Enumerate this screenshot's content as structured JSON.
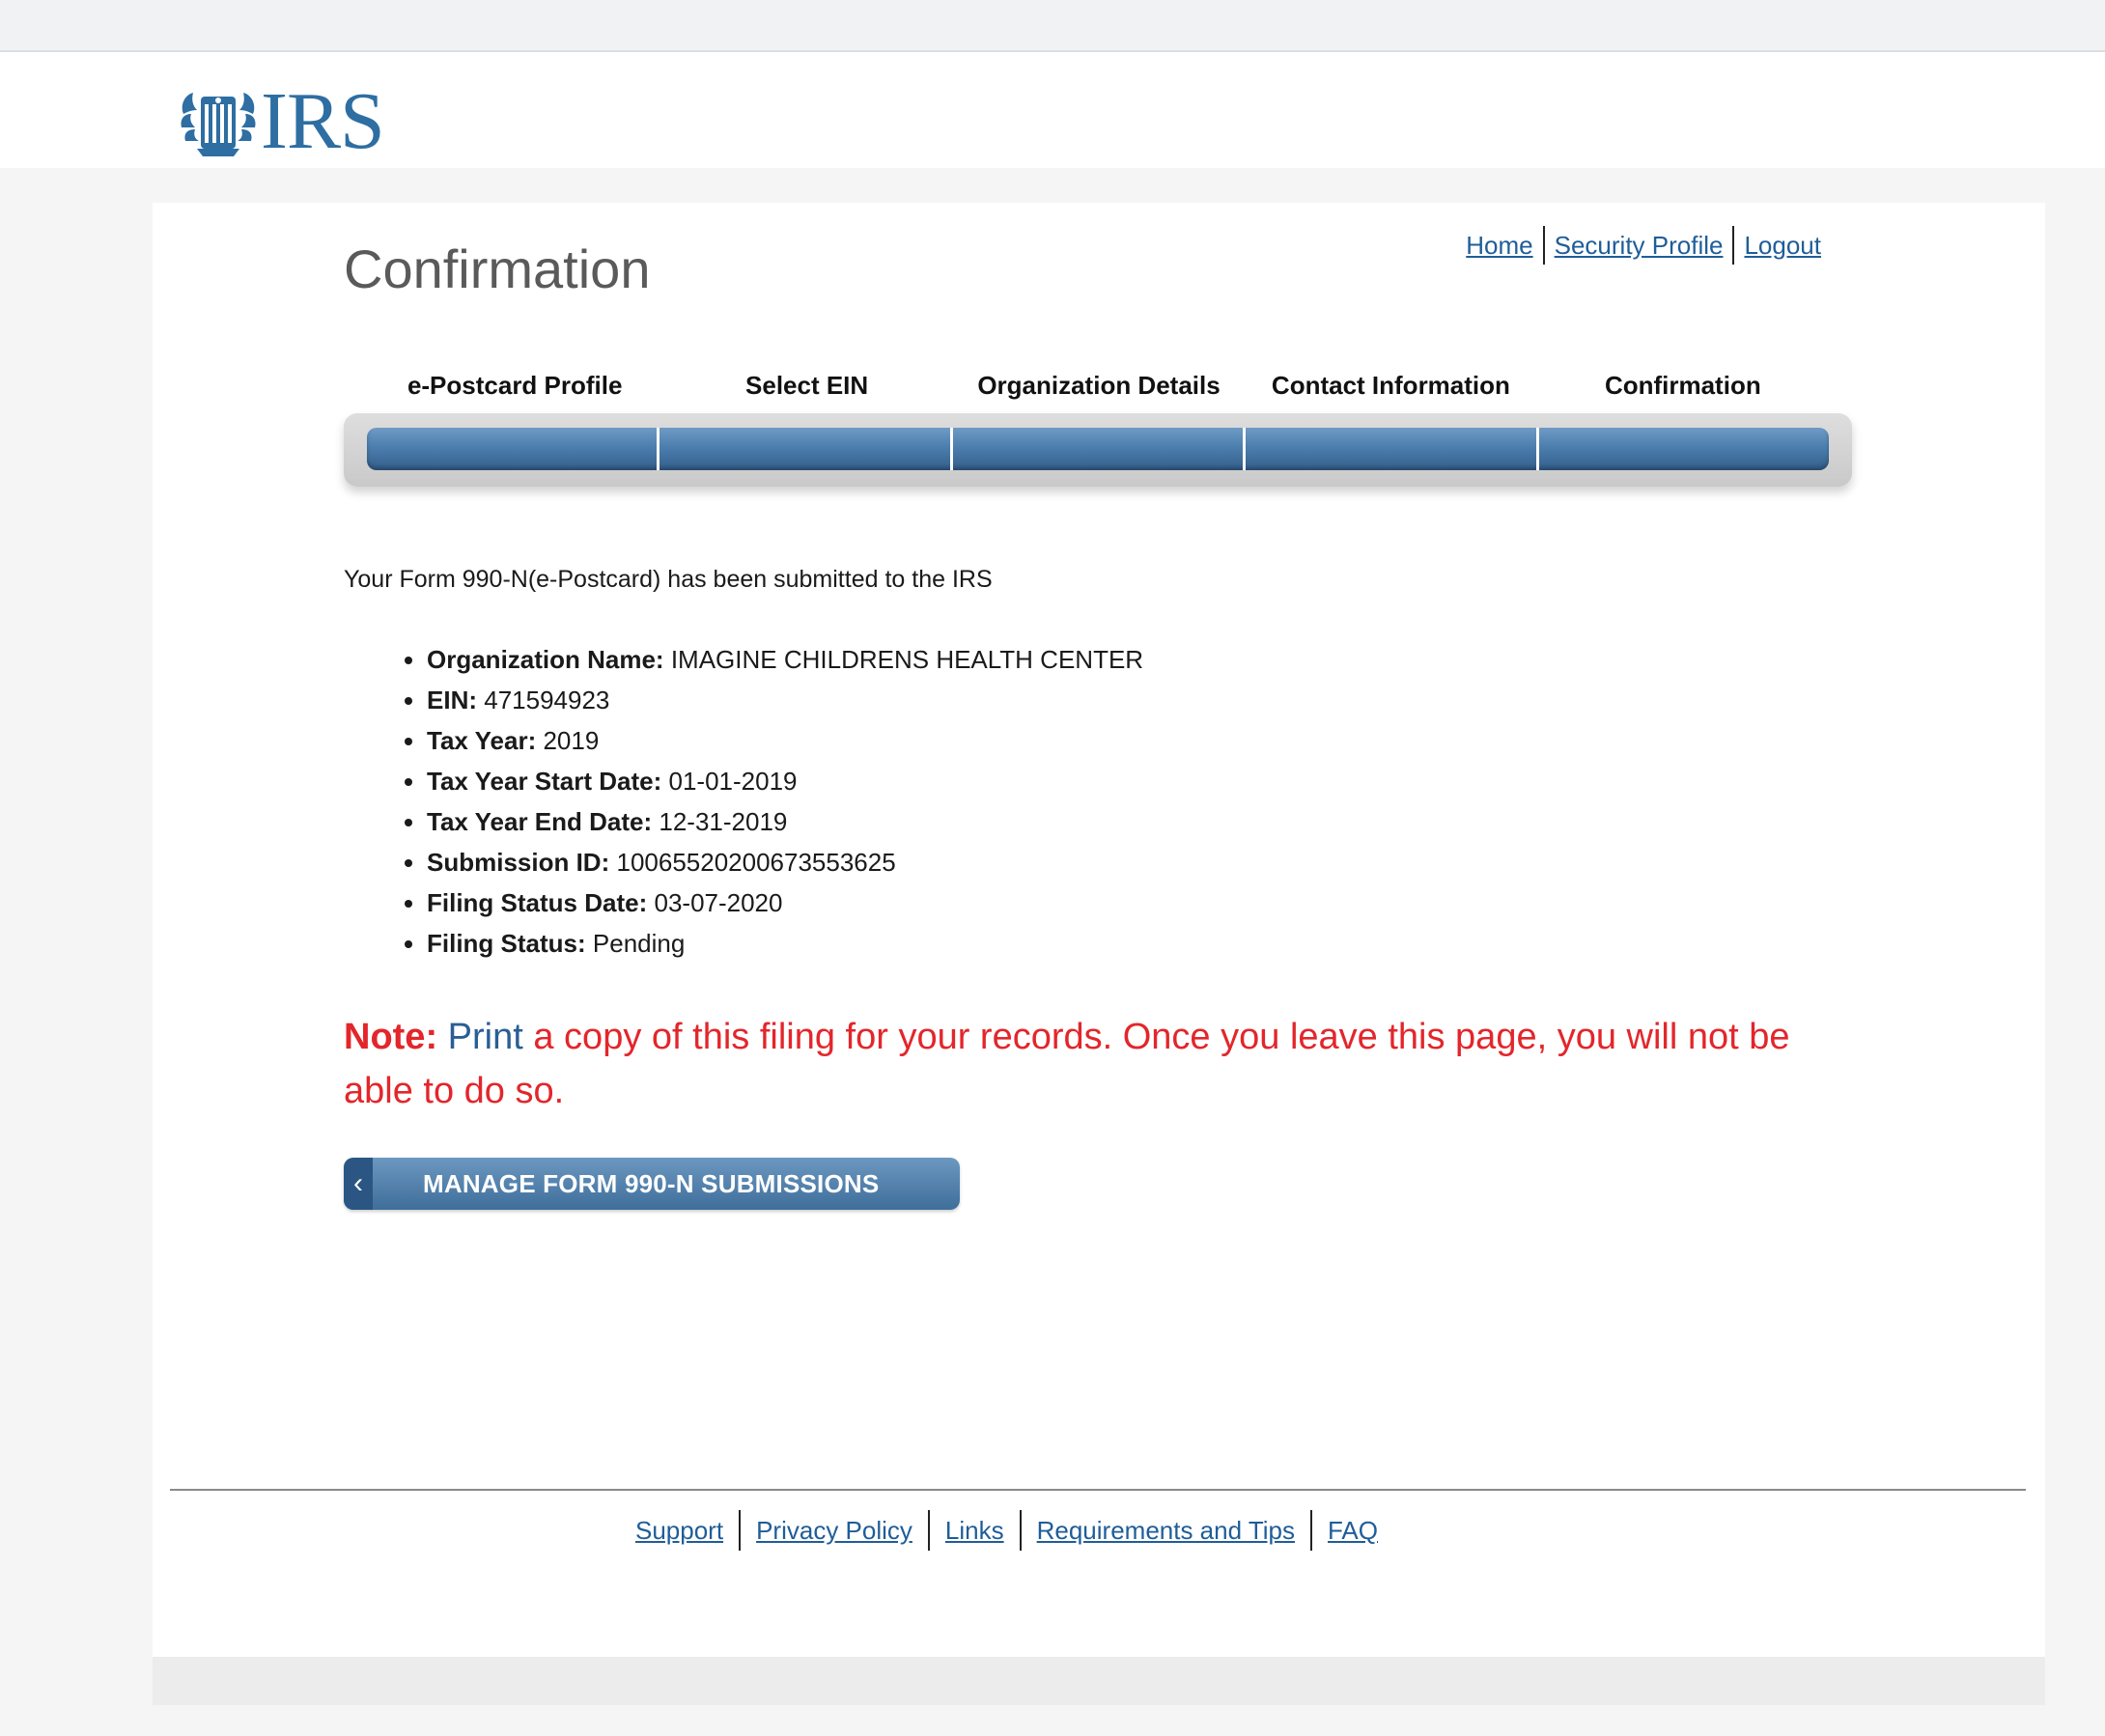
{
  "header": {
    "logo_text": "IRS"
  },
  "page": {
    "title": "Confirmation"
  },
  "top_links": [
    {
      "label": "Home"
    },
    {
      "label": "Security Profile"
    },
    {
      "label": "Logout"
    }
  ],
  "steps": [
    {
      "label": "e-Postcard Profile"
    },
    {
      "label": "Select EIN"
    },
    {
      "label": "Organization Details"
    },
    {
      "label": "Contact Information"
    },
    {
      "label": "Confirmation"
    }
  ],
  "progress": {
    "completed_steps": 5,
    "total_steps": 5,
    "color": "#4c7eae"
  },
  "confirmation": {
    "message": "Your Form 990-N(e-Postcard) has been submitted to the IRS",
    "details": [
      {
        "label": "Organization Name:",
        "value": "IMAGINE CHILDRENS HEALTH CENTER"
      },
      {
        "label": "EIN:",
        "value": "471594923"
      },
      {
        "label": "Tax Year:",
        "value": "2019"
      },
      {
        "label": "Tax Year Start Date:",
        "value": "01-01-2019"
      },
      {
        "label": "Tax Year End Date:",
        "value": "12-31-2019"
      },
      {
        "label": "Submission ID:",
        "value": "10065520200673553625"
      },
      {
        "label": "Filing Status Date:",
        "value": "03-07-2020"
      },
      {
        "label": "Filing Status:",
        "value": "Pending"
      }
    ]
  },
  "note": {
    "label": "Note:",
    "print_link": "Print",
    "text": " a copy of this filing for your records. Once you leave this page, you will not be able to do so.",
    "color": "#e3262b"
  },
  "manage_button": {
    "label": "MANAGE FORM 990-N SUBMISSIONS",
    "icon": "chevron-left-icon"
  },
  "footer_links": [
    {
      "label": "Support"
    },
    {
      "label": "Privacy Policy"
    },
    {
      "label": "Links"
    },
    {
      "label": "Requirements and Tips"
    },
    {
      "label": "FAQ"
    }
  ],
  "colors": {
    "link": "#1f5d99",
    "brand": "#2e6ea2",
    "note_red": "#e3262b"
  }
}
